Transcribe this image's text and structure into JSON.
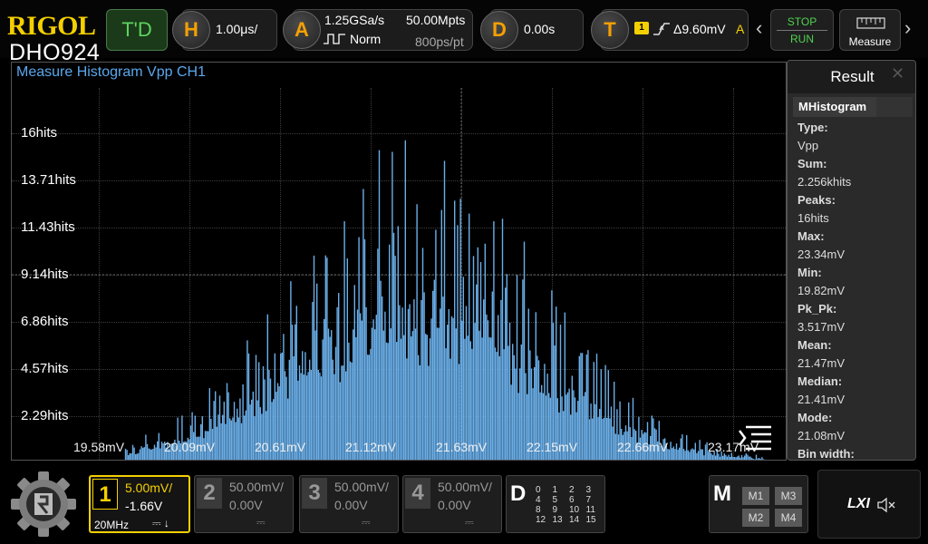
{
  "brand": {
    "name": "RIGOL",
    "model": "DHO924"
  },
  "topbar": {
    "td_label": "T'D",
    "horizontal": {
      "key": "H",
      "timebase": "1.00μs/"
    },
    "acquire": {
      "key": "A",
      "sample_rate": "1.25GSa/s",
      "mode": "Norm",
      "memory_depth": "50.00Mpts",
      "sample_interval": "800ps/pt"
    },
    "delay": {
      "key": "D",
      "value": "0.00s"
    },
    "trigger": {
      "key": "T",
      "source": "1",
      "level": "Δ9.60mV",
      "mode": "A"
    },
    "stop_label": "STOP",
    "run_label": "RUN",
    "measure_label": "Measure"
  },
  "screen": {
    "title": "Measure Histogram  Vpp  CH1",
    "y_labels": [
      "16hits",
      "13.71hits",
      "11.43hits",
      "9.14hits",
      "6.86hits",
      "4.57hits",
      "2.29hits"
    ],
    "x_labels": [
      "19.58mV",
      "20.09mV",
      "20.61mV",
      "21.12mV",
      "21.63mV",
      "22.15mV",
      "22.66mV",
      "23.17mV"
    ]
  },
  "chart_data": {
    "type": "bar",
    "title": "Measure Histogram  Vpp  CH1",
    "xlabel": "",
    "ylabel": "",
    "x_range": [
      19.58,
      23.17
    ],
    "ylim": [
      0,
      16
    ],
    "peak_hits": 16,
    "total_hits": 2256,
    "min_mV": 19.82,
    "max_mV": 23.34,
    "mean_mV": 21.47,
    "median_mV": 21.41,
    "mode_mV": 21.08,
    "color": "#6aaee8"
  },
  "result": {
    "title": "Result",
    "tab": "MHistogram",
    "items": [
      {
        "label": "Type:",
        "value": "Vpp"
      },
      {
        "label": "Sum:",
        "value": "2.256khits"
      },
      {
        "label": "Peaks:",
        "value": "16hits"
      },
      {
        "label": "Max:",
        "value": "23.34mV"
      },
      {
        "label": "Min:",
        "value": "19.82mV"
      },
      {
        "label": "Pk_Pk:",
        "value": "3.517mV"
      },
      {
        "label": "Mean:",
        "value": "21.47mV"
      },
      {
        "label": "Median:",
        "value": "21.41mV"
      },
      {
        "label": "Mode:",
        "value": "21.08mV"
      },
      {
        "label": "Bin width:",
        "value": ""
      }
    ]
  },
  "channels": [
    {
      "num": "1",
      "scale": "5.00mV/",
      "offset": "-1.66V",
      "bandwidth": "20MHz",
      "coupling": "⎓ ↓",
      "active": true
    },
    {
      "num": "2",
      "scale": "50.00mV/",
      "offset": "0.00V",
      "coupling": "⎓",
      "active": false
    },
    {
      "num": "3",
      "scale": "50.00mV/",
      "offset": "0.00V",
      "coupling": "⎓",
      "active": false
    },
    {
      "num": "4",
      "scale": "50.00mV/",
      "offset": "0.00V",
      "coupling": "⎓",
      "active": false
    }
  ],
  "digital": {
    "label": "D",
    "channels": [
      "0",
      "1",
      "2",
      "3",
      "4",
      "5",
      "6",
      "7",
      "8",
      "9",
      "10",
      "11",
      "12",
      "13",
      "14",
      "15"
    ]
  },
  "math": {
    "label": "M",
    "buttons": [
      "M1",
      "M3",
      "M2",
      "M4"
    ]
  },
  "lxi": {
    "label": "LXI"
  },
  "colors": {
    "accent": "#f5d000",
    "trace": "#6aaee8",
    "td": "#5fd35f",
    "circle_key": "#f5a000"
  }
}
